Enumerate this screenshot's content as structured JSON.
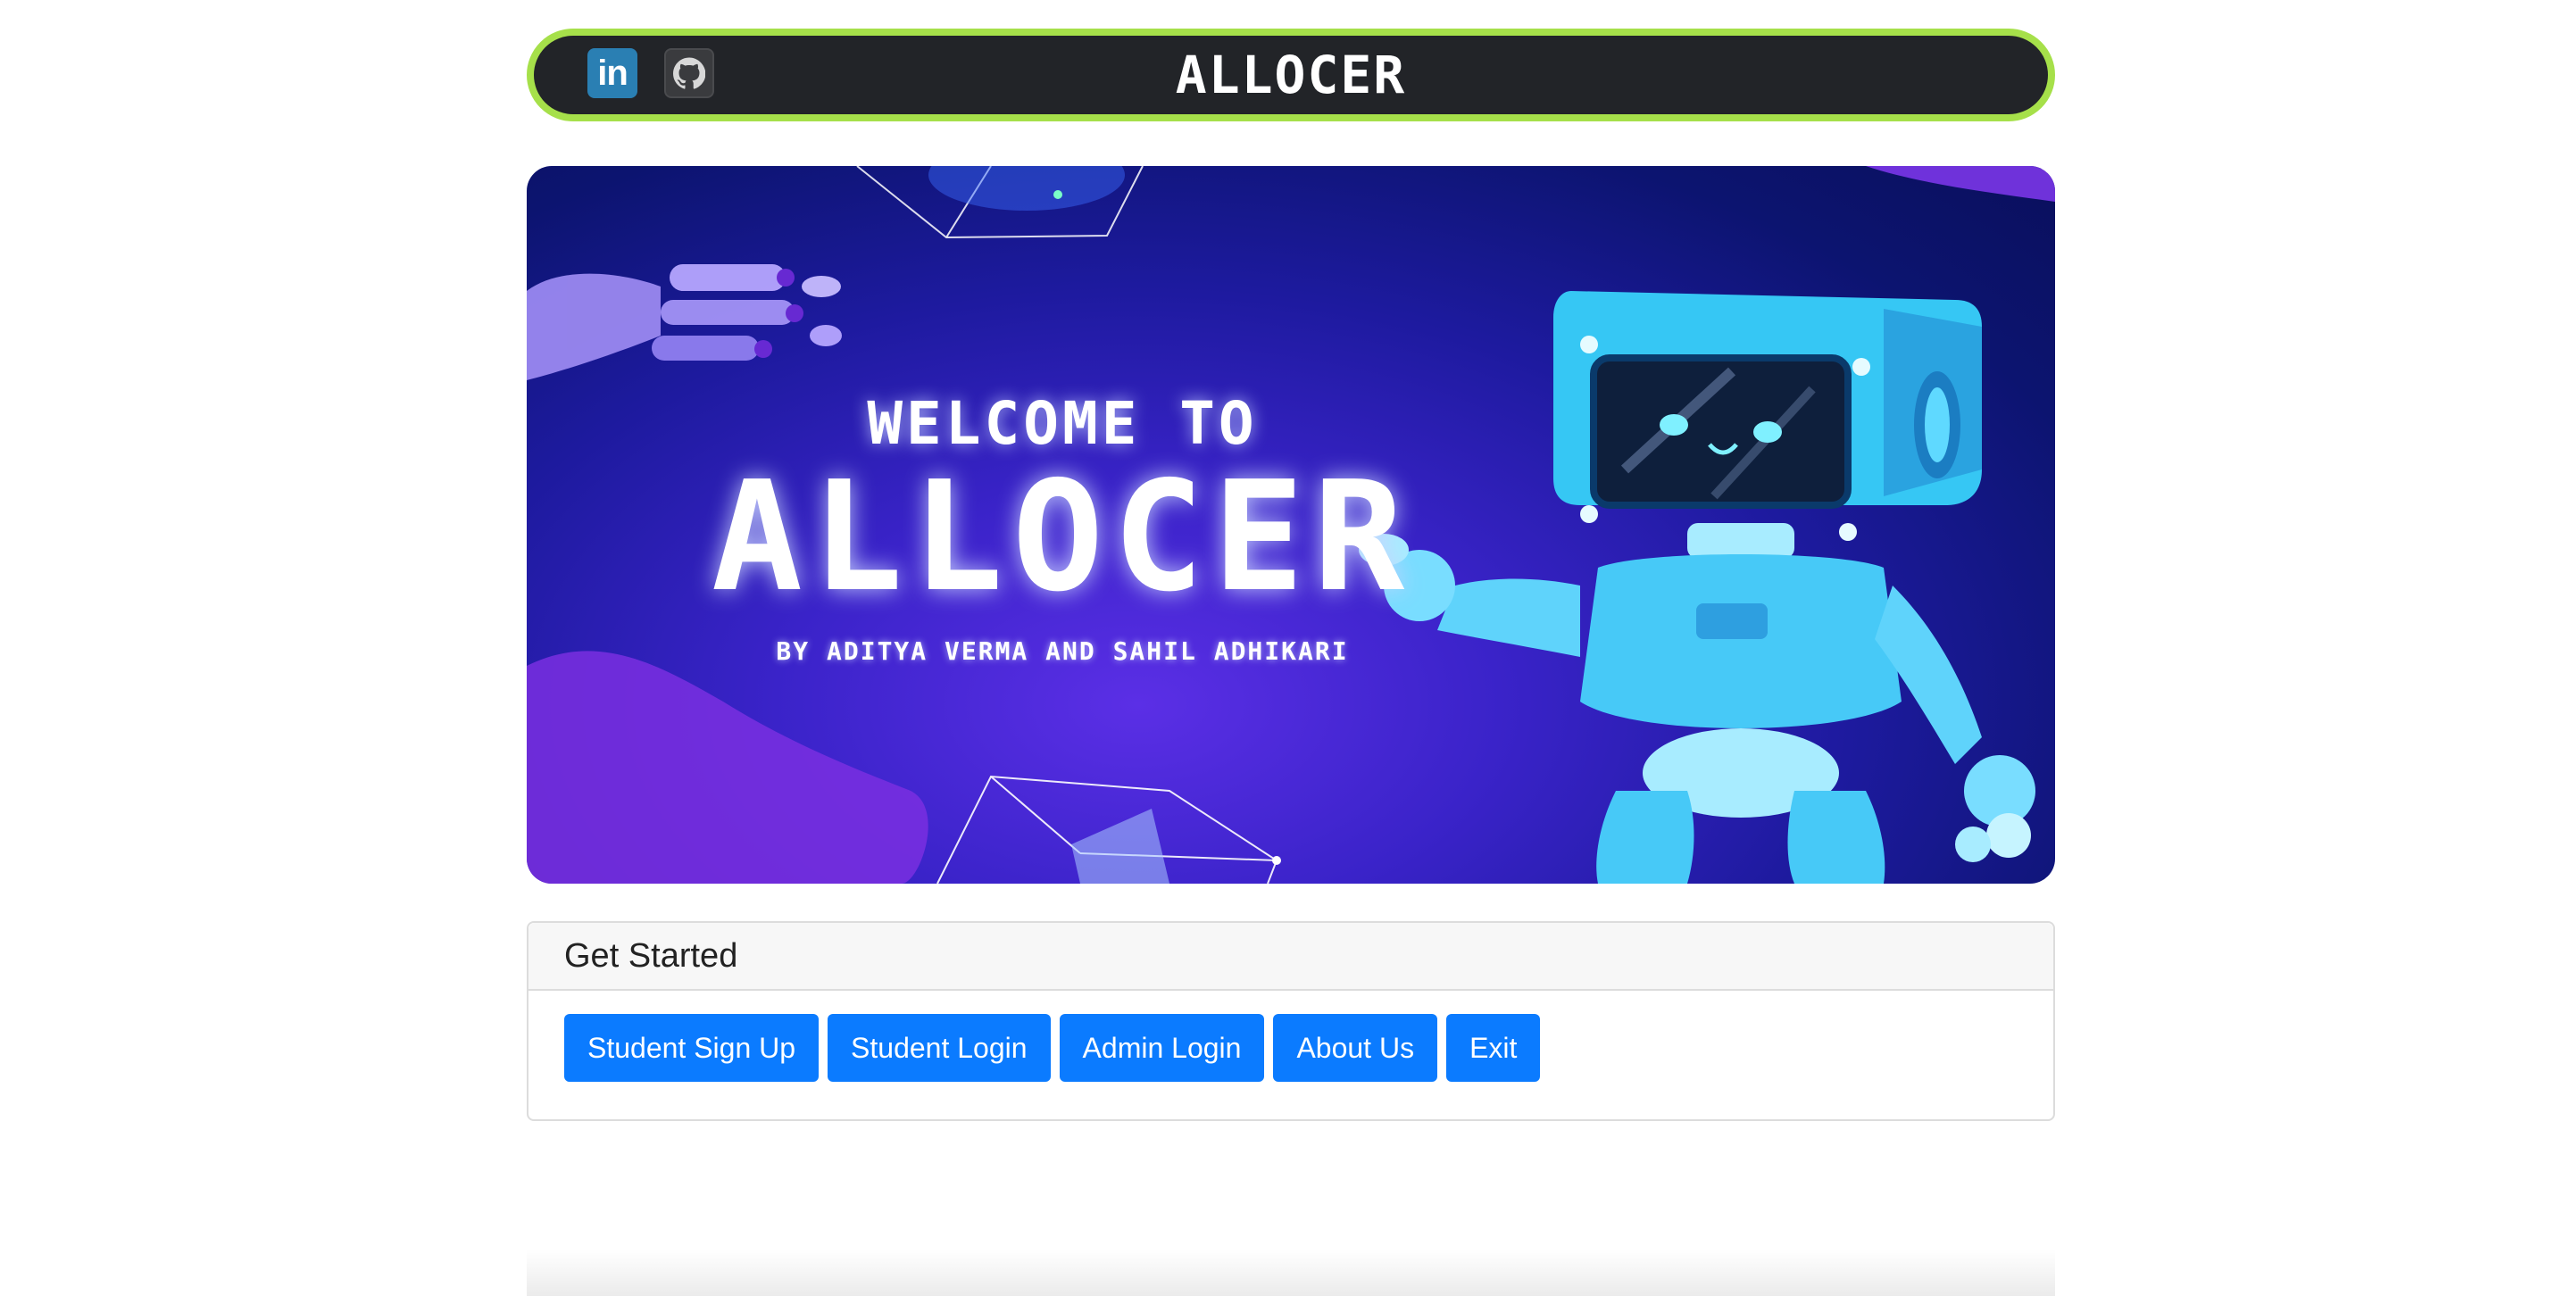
{
  "navbar": {
    "brand": "ALLOCER",
    "linkedin_text": "in",
    "accent_border": "#a6e04a",
    "background": "#222428"
  },
  "hero": {
    "welcome": "WELCOME TO",
    "title": "ALLOCER",
    "byline": "BY ADITYA VERMA AND SAHIL ADHIKARI"
  },
  "card": {
    "header": "Get Started",
    "buttons": [
      {
        "label": "Student Sign Up"
      },
      {
        "label": "Student Login"
      },
      {
        "label": "Admin Login"
      },
      {
        "label": "About Us"
      },
      {
        "label": "Exit"
      }
    ],
    "button_color": "#0b7bff"
  }
}
